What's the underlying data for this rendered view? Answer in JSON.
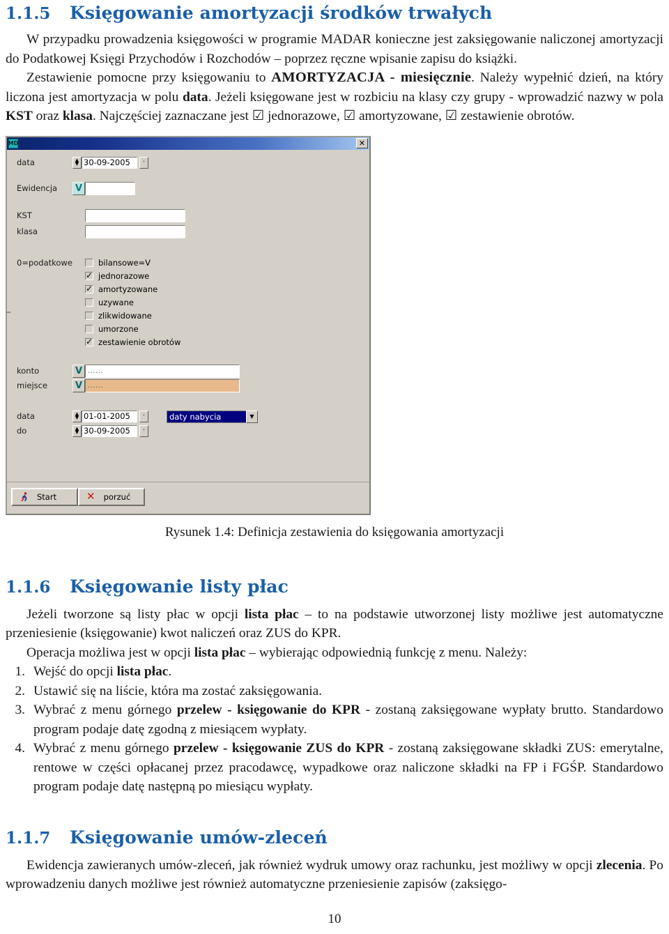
{
  "sections": {
    "s115": {
      "number": "1.1.5",
      "title": "Księgowanie amortyzacji środków trwałych",
      "p1_a": "W przypadku prowadzenia księgowości w programie MADAR konieczne jest zaksięgowanie naliczonej amortyzacji do Podatkowej Księgi Przychodów i Rozchodów – poprzez ręczne wpisanie zapisu do książki.",
      "p2_a": "Zestawienie pomocne przy księgowaniu to ",
      "p2_b": "AMORTYZACJA - miesięcznie",
      "p2_c": ". Należy wypełnić dzień, na który liczona jest amortyzacja w polu ",
      "p2_d": "data",
      "p2_e": ". Jeżeli księgowane jest w rozbiciu na klasy czy grupy - wprowadzić nazwy w pola ",
      "p2_f": "KST",
      "p2_g": " oraz ",
      "p2_h": "klasa",
      "p2_i": ". Najczęściej zaznaczane jest ☑ jednorazowe, ☑ amortyzowane, ☑ zestawienie obrotów."
    },
    "s116": {
      "number": "1.1.6",
      "title": "Księgowanie listy płac",
      "p1_a": "Jeżeli tworzone są listy płac w opcji ",
      "p1_b": "lista płac",
      "p1_c": " – to na podstawie utworzonej listy możliwe jest automatyczne przeniesienie (księgowanie) kwot naliczeń oraz ZUS do KPR.",
      "p2_a": "Operacja możliwa jest w opcji ",
      "p2_b": "lista płac",
      "p2_c": " – wybierając odpowiednią funkcję z menu. Należy:",
      "steps": [
        {
          "n": "1.",
          "pre": "Wejść do opcji ",
          "bold": "lista płac",
          "post": "."
        },
        {
          "n": "2.",
          "pre": "Ustawić się na liście, która ma zostać zaksięgowania.",
          "bold": "",
          "post": ""
        },
        {
          "n": "3.",
          "pre": "Wybrać z menu górnego ",
          "bold": "przelew - księgowanie do KPR",
          "post": " - zostaną zaksięgowane wypłaty brutto. Standardowo program podaje datę zgodną z miesiącem wypłaty."
        },
        {
          "n": "4.",
          "pre": "Wybrać z menu górnego ",
          "bold": "przelew - księgowanie ZUS do KPR",
          "post": " - zostaną zaksięgowane składki ZUS: emerytalne, rentowe w części opłacanej przez pracodawcę, wypadkowe oraz naliczone składki na FP i FGŚP. Standardowo program podaje datę następną po miesiącu wypłaty."
        }
      ]
    },
    "s117": {
      "number": "1.1.7",
      "title": "Księgowanie umów-zleceń",
      "p1_a": "Ewidencja zawieranych umów-zleceń, jak również wydruk umowy oraz rachunku, jest możliwy w opcji ",
      "p1_b": "zlecenia",
      "p1_c": ". Po wprowadzeniu danych możliwe jest również automatyczne przeniesienie zapisów (zaksięgo-"
    }
  },
  "figure": {
    "caption": "Rysunek 1.4: Definicja zestawienia do księgowania amortyzacji",
    "dialog": {
      "app_icon_label": "MD",
      "close_label": "✕",
      "date_top": {
        "label": "data",
        "value": "30-09-2005",
        "spin_up": "▲",
        "spin_down": "▼",
        "dot": "·"
      },
      "ewidencja": {
        "label": "Ewidencja",
        "value": "",
        "vbutton": "V"
      },
      "kst": {
        "label": "KST",
        "value": ""
      },
      "klasa": {
        "label": "klasa",
        "value": ""
      },
      "group_label": "0=podatkowe",
      "checkboxes": [
        {
          "label": "bilansowe=V",
          "checked": false
        },
        {
          "label": "jednorazowe",
          "checked": true
        },
        {
          "label": "amortyzowane",
          "checked": true
        },
        {
          "label": "uzywane",
          "checked": false
        },
        {
          "label": "zlikwidowane",
          "checked": false
        },
        {
          "label": "umorzone",
          "checked": false
        },
        {
          "label": "zestawienie obrotów",
          "checked": true
        }
      ],
      "konto": {
        "label": "konto",
        "value": "......",
        "vbutton": "V"
      },
      "miejsce": {
        "label": "miejsce",
        "value": "......",
        "vbutton": "V"
      },
      "date_from": {
        "label": "data",
        "value": "01-01-2005",
        "dot": "·"
      },
      "date_to": {
        "label": "do",
        "value": "30-09-2005",
        "dot": "·"
      },
      "combo": {
        "value": "daty nabycia",
        "arrow": "▼"
      },
      "buttons": {
        "start": "Start",
        "cancel": "porzuć",
        "cancel_icon": "✕"
      }
    }
  },
  "page_number": "10",
  "colors": {
    "heading": "#1a5fa8",
    "dialog_face": "#d4d0c8",
    "titlebar_dark": "#0a246a",
    "titlebar_light": "#a6c8f0",
    "combo_selection": "#00007f",
    "miejsce_field": "#e7b98b",
    "vbutton_teal": "#bfe3e3",
    "cancel_red": "#d01010"
  }
}
